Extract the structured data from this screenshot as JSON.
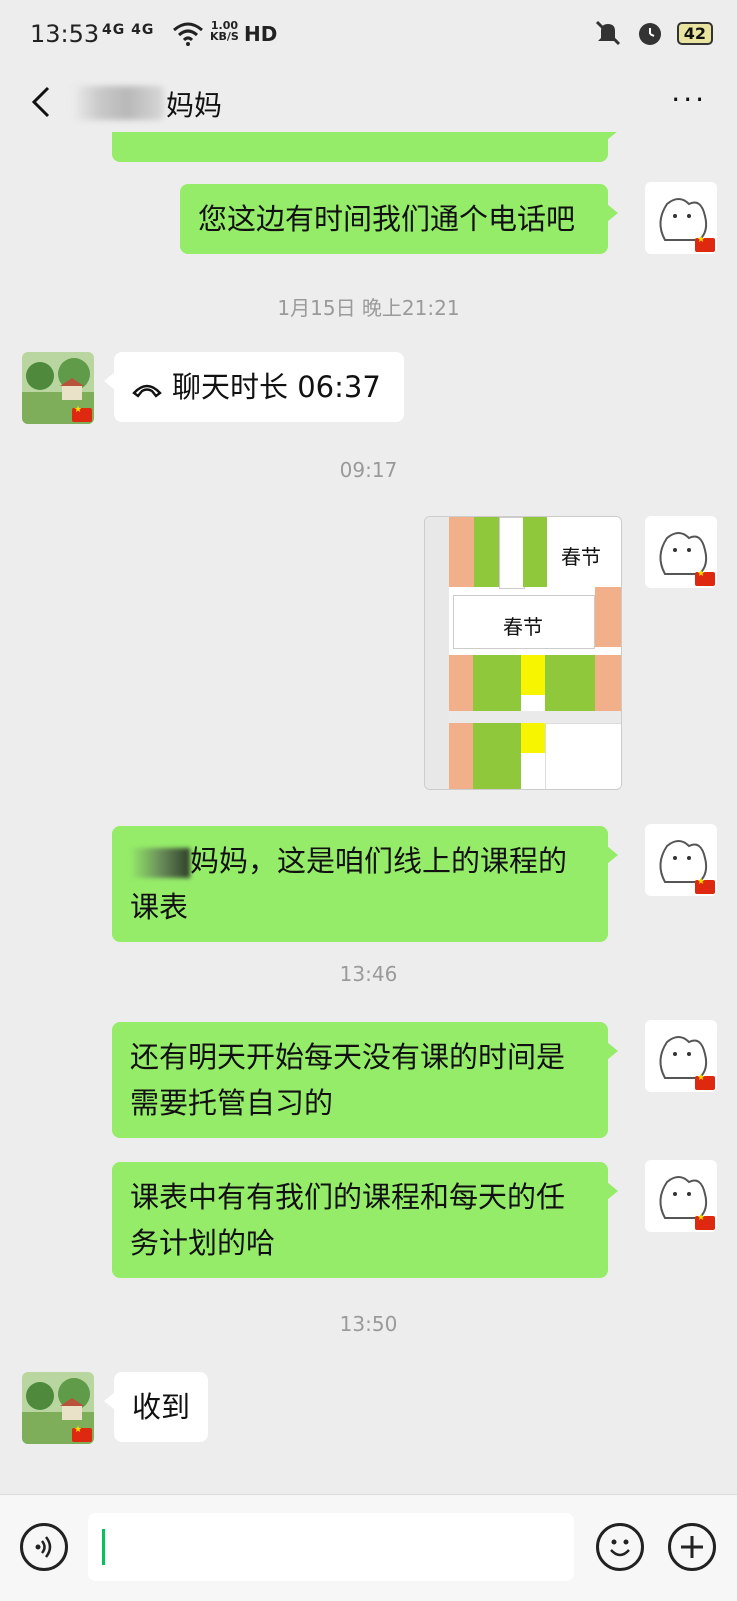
{
  "status_bar": {
    "time": "13:53",
    "network": "4G 4G",
    "speed_value": "1.00",
    "speed_unit": "KB/S",
    "hd": "HD",
    "battery": "42",
    "icons": [
      "signal-icon",
      "wifi-icon",
      "mute-icon",
      "alarm-icon",
      "battery-icon"
    ]
  },
  "nav": {
    "title": "妈妈",
    "more": "···"
  },
  "messages": {
    "m1": "您这边有时间我们通个电话吧",
    "ts1": "1月15日 晚上21:21",
    "call_text": "聊天时长 06:37",
    "ts2": "09:17",
    "image_label_1": "春节",
    "image_label_2": "春节",
    "m2_suffix": "妈妈，这是咱们线上的课程的",
    "m2_line2": "课表",
    "ts3": "13:46",
    "m3_line1": "还有明天开始每天没有课的时间是",
    "m3_line2": "需要托管自习的",
    "m4_line1": "课表中有有我们的课程和每天的任",
    "m4_line2": "务计划的哈",
    "ts4": "13:50",
    "m5": "收到"
  },
  "colors": {
    "background": "#ededed",
    "self_bubble": "#95ec69",
    "other_bubble": "#ffffff",
    "accent": "#07c160"
  }
}
